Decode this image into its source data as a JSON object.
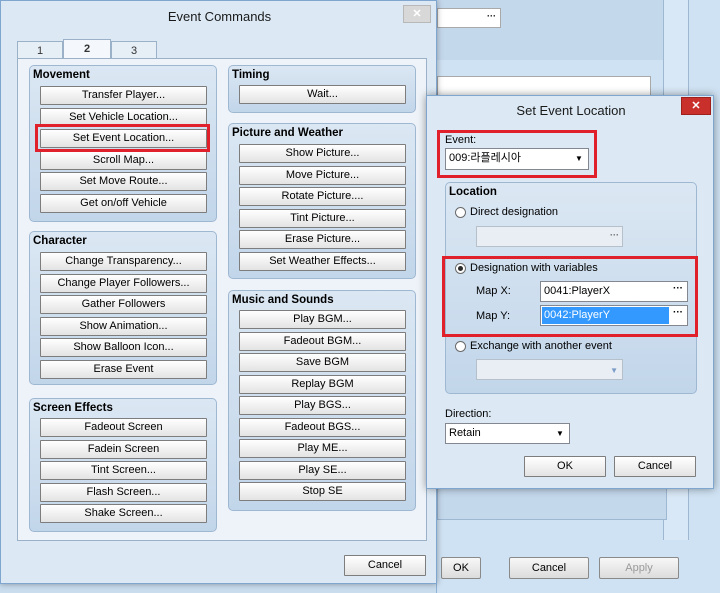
{
  "event_commands": {
    "title": "Event Commands",
    "tabs": [
      "1",
      "2",
      "3"
    ],
    "movement": {
      "title": "Movement",
      "buttons": [
        "Transfer Player...",
        "Set Vehicle Location...",
        "Set Event Location...",
        "Scroll Map...",
        "Set Move Route...",
        "Get on/off Vehicle"
      ]
    },
    "character": {
      "title": "Character",
      "buttons": [
        "Change Transparency...",
        "Change Player Followers...",
        "Gather Followers",
        "Show Animation...",
        "Show Balloon Icon...",
        "Erase Event"
      ]
    },
    "screen_effects": {
      "title": "Screen Effects",
      "buttons": [
        "Fadeout Screen",
        "Fadein Screen",
        "Tint Screen...",
        "Flash Screen...",
        "Shake Screen..."
      ]
    },
    "timing": {
      "title": "Timing",
      "buttons": [
        "Wait..."
      ]
    },
    "picture_weather": {
      "title": "Picture and Weather",
      "buttons": [
        "Show Picture...",
        "Move Picture...",
        "Rotate Picture....",
        "Tint Picture...",
        "Erase Picture...",
        "Set Weather Effects..."
      ]
    },
    "music_sounds": {
      "title": "Music and Sounds",
      "buttons": [
        "Play BGM...",
        "Fadeout BGM...",
        "Save BGM",
        "Replay BGM",
        "Play BGS...",
        "Fadeout BGS...",
        "Play ME...",
        "Play SE...",
        "Stop SE"
      ]
    },
    "cancel_label": "Cancel"
  },
  "set_event_location": {
    "title": "Set Event Location",
    "event_label": "Event:",
    "event_value": "009:라플레시아",
    "location_title": "Location",
    "direct_label": "Direct designation",
    "variables_label": "Designation with variables",
    "map_x_label": "Map X:",
    "map_x_value": "0041:PlayerX",
    "map_y_label": "Map Y:",
    "map_y_value": "0042:PlayerY",
    "exchange_label": "Exchange with another event",
    "direction_label": "Direction:",
    "direction_value": "Retain",
    "ok_label": "OK",
    "cancel_label": "Cancel"
  },
  "background_window": {
    "ok_label": "OK",
    "cancel_label": "Cancel",
    "apply_label": "Apply"
  }
}
